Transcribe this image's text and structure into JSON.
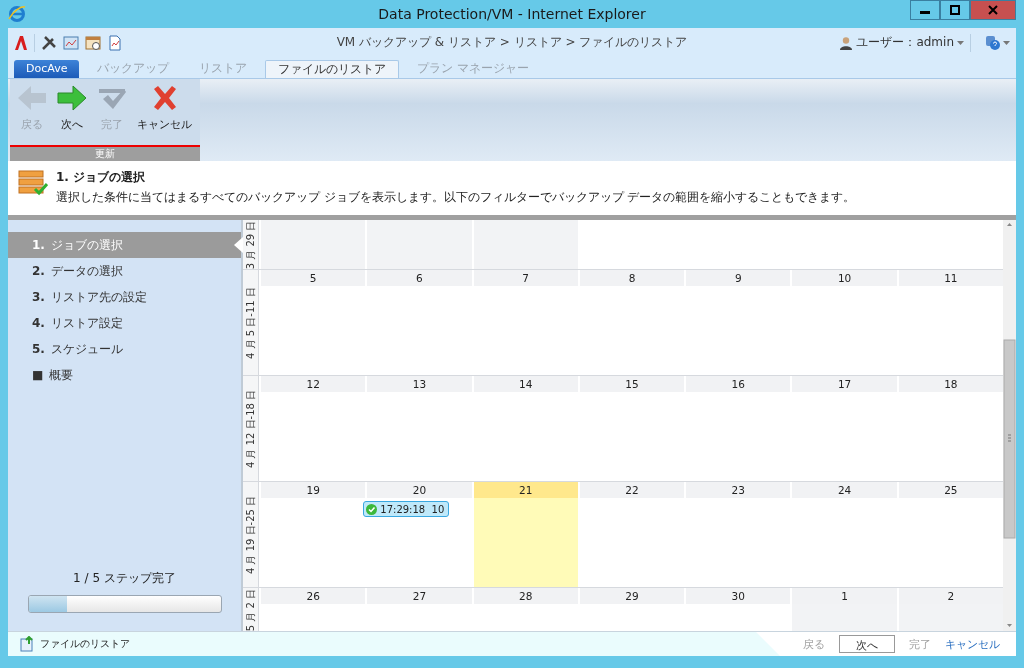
{
  "window": {
    "title": "Data Protection/VM - Internet Explorer"
  },
  "topbar": {
    "breadcrumb": "VM バックアップ & リストア > リストア > ファイルのリストア",
    "user": "ユーザー：admin"
  },
  "tabs": [
    {
      "label": "DocAve",
      "kind": "home",
      "selected": false
    },
    {
      "label": "バックアップ",
      "kind": "normal",
      "selected": false
    },
    {
      "label": "リストア",
      "kind": "normal",
      "selected": false
    },
    {
      "label": "ファイルのリストア",
      "kind": "normal",
      "selected": true
    },
    {
      "label": "プラン マネージャー",
      "kind": "normal",
      "selected": false
    }
  ],
  "ribbon": {
    "group": "更新",
    "buttons": [
      {
        "label": "戻る",
        "kind": "back",
        "disabled": true
      },
      {
        "label": "次へ",
        "kind": "next",
        "disabled": false
      },
      {
        "label": "完了",
        "kind": "finish",
        "disabled": true
      },
      {
        "label": "キャンセル",
        "kind": "cancel",
        "disabled": false
      }
    ]
  },
  "description": {
    "title": "1. ジョブの選択",
    "text": "選択した条件に当てはまるすべてのバックアップ ジョブを表示します。以下のフィルターでバックアップ データの範囲を縮小することもできます。"
  },
  "steps": [
    {
      "number": "1.",
      "label": "ジョブの選択",
      "selected": true
    },
    {
      "number": "2.",
      "label": "データの選択",
      "selected": false
    },
    {
      "number": "3.",
      "label": "リストア先の設定",
      "selected": false
    },
    {
      "number": "4.",
      "label": "リストア設定",
      "selected": false
    },
    {
      "number": "5.",
      "label": "スケジュール",
      "selected": false
    },
    {
      "number": "■",
      "label": "概要",
      "selected": false
    }
  ],
  "progress": {
    "label": "1 / 5 ステップ完了",
    "level": 0.2
  },
  "calendar": {
    "weeks": [
      {
        "label": "3 月 29 日",
        "days": [
          {
            "kind": "other"
          },
          {
            "kind": "other"
          },
          {
            "kind": "other"
          },
          {
            "kind": "blank"
          },
          {
            "kind": "blank"
          },
          {
            "kind": "blank"
          },
          {
            "kind": "blank"
          }
        ]
      },
      {
        "label": "4 月 5 日-11 日",
        "days": [
          {
            "day": "5",
            "kind": "current"
          },
          {
            "day": "6",
            "kind": "current"
          },
          {
            "day": "7",
            "kind": "current"
          },
          {
            "day": "8",
            "kind": "current"
          },
          {
            "day": "9",
            "kind": "current"
          },
          {
            "day": "10",
            "kind": "current"
          },
          {
            "day": "11",
            "kind": "current"
          }
        ]
      },
      {
        "label": "4 月 12 日-18 日",
        "days": [
          {
            "day": "12",
            "kind": "current"
          },
          {
            "day": "13",
            "kind": "current"
          },
          {
            "day": "14",
            "kind": "current"
          },
          {
            "day": "15",
            "kind": "current"
          },
          {
            "day": "16",
            "kind": "current"
          },
          {
            "day": "17",
            "kind": "current"
          },
          {
            "day": "18",
            "kind": "current"
          }
        ]
      },
      {
        "label": "4 月 19 日-25 日",
        "days": [
          {
            "day": "19",
            "kind": "current"
          },
          {
            "day": "20",
            "kind": "current",
            "events": [
              {
                "text": "17:29:18  10"
              }
            ]
          },
          {
            "day": "21",
            "kind": "today"
          },
          {
            "day": "22",
            "kind": "current"
          },
          {
            "day": "23",
            "kind": "current"
          },
          {
            "day": "24",
            "kind": "current"
          },
          {
            "day": "25",
            "kind": "current"
          }
        ]
      },
      {
        "label": "5 月 2 日",
        "days": [
          {
            "day": "26",
            "kind": "current"
          },
          {
            "day": "27",
            "kind": "current"
          },
          {
            "day": "28",
            "kind": "current"
          },
          {
            "day": "29",
            "kind": "current"
          },
          {
            "day": "30",
            "kind": "current"
          },
          {
            "day": "1",
            "kind": "other"
          },
          {
            "day": "2",
            "kind": "other"
          }
        ]
      }
    ]
  },
  "footer": {
    "title": "ファイルのリストア",
    "buttons": [
      {
        "label": "戻る",
        "kind": "plain",
        "disabled": true
      },
      {
        "label": "次へ",
        "kind": "boxed",
        "disabled": false
      },
      {
        "label": "完了",
        "kind": "plain",
        "disabled": true
      },
      {
        "label": "キャンセル",
        "kind": "link",
        "disabled": false
      }
    ]
  }
}
